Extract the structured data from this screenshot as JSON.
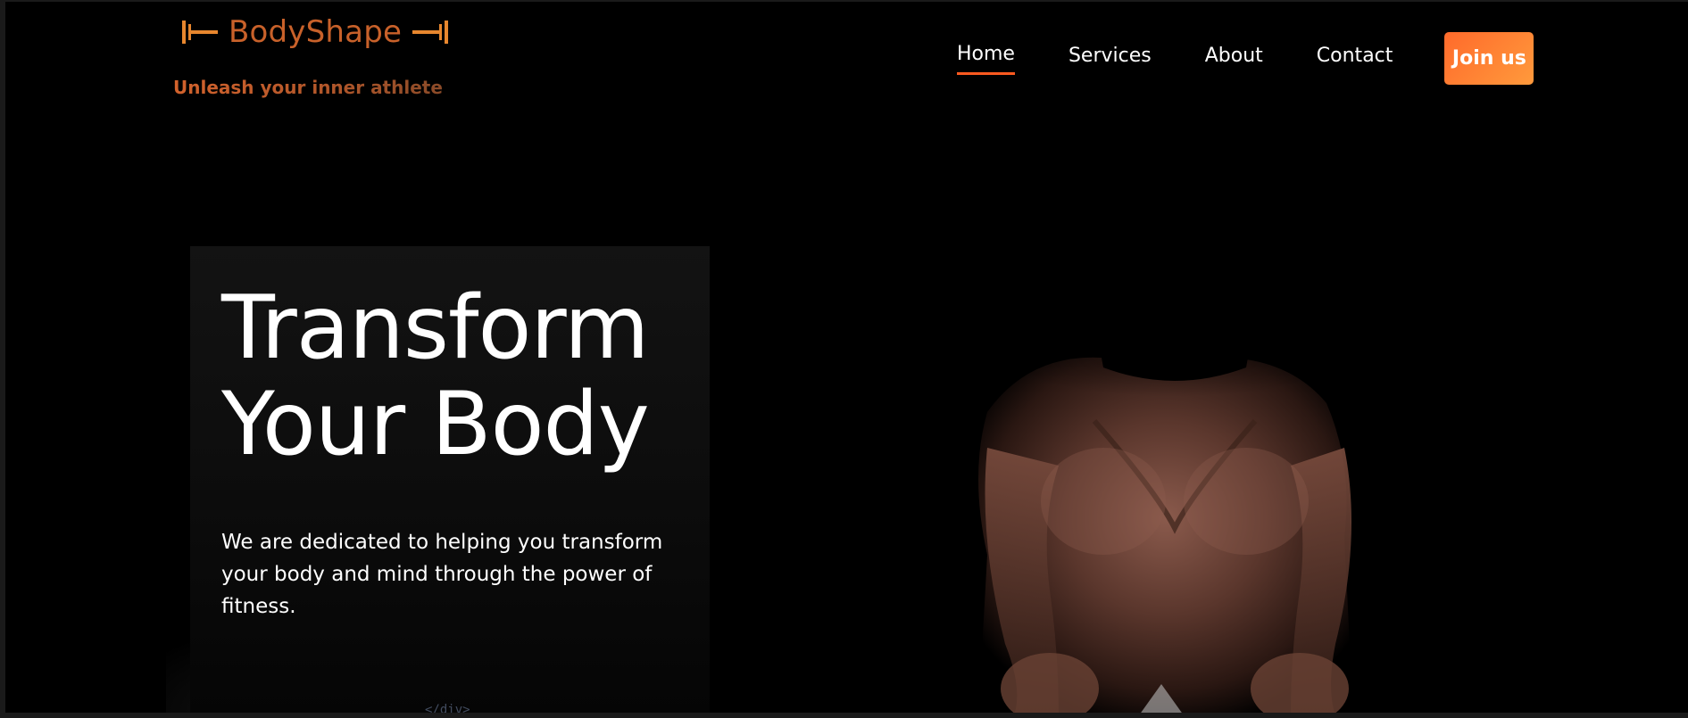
{
  "brand": {
    "name": "BodyShape",
    "tagline": "Unleash your inner athlete",
    "icon_left": "dumbbell-icon",
    "icon_right": "dumbbell-icon",
    "color": "#c8612a"
  },
  "nav": {
    "items": [
      {
        "label": "Home",
        "active": true
      },
      {
        "label": "Services",
        "active": false
      },
      {
        "label": "About",
        "active": false
      },
      {
        "label": "Contact",
        "active": false
      }
    ],
    "cta_label": "Join us",
    "accent": "#ff6a2b"
  },
  "hero": {
    "title_line1": "Transform",
    "title_line2": "Your Body",
    "description": "We are dedicated to helping you transform your body and mind through the power of fitness.",
    "image": "athlete-photo"
  },
  "footer_peek": "</div>"
}
